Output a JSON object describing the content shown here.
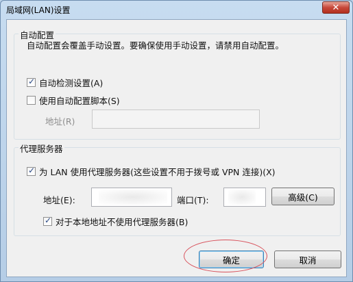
{
  "window": {
    "title": "局域网(LAN)设置",
    "close_label": "✕"
  },
  "auto_config": {
    "group_title": "自动配置",
    "description": "自动配置会覆盖手动设置。要确保使用手动设置，请禁用自动配置。",
    "auto_detect_label": "自动检测设置(A)",
    "auto_detect_checked": true,
    "use_script_label": "使用自动配置脚本(S)",
    "use_script_checked": false,
    "address_label": "地址(R)",
    "address_value": ""
  },
  "proxy": {
    "group_title": "代理服务器",
    "use_proxy_label": "为 LAN 使用代理服务器(这些设置不用于拨号或 VPN 连接)(X)",
    "use_proxy_checked": true,
    "address_label": "地址(E):",
    "address_value": "",
    "port_label": "端口(T):",
    "port_value": "",
    "advanced_label": "高级(C)",
    "bypass_local_label": "对于本地地址不使用代理服务器(B)",
    "bypass_local_checked": true
  },
  "footer": {
    "ok_label": "确定",
    "cancel_label": "取消"
  }
}
